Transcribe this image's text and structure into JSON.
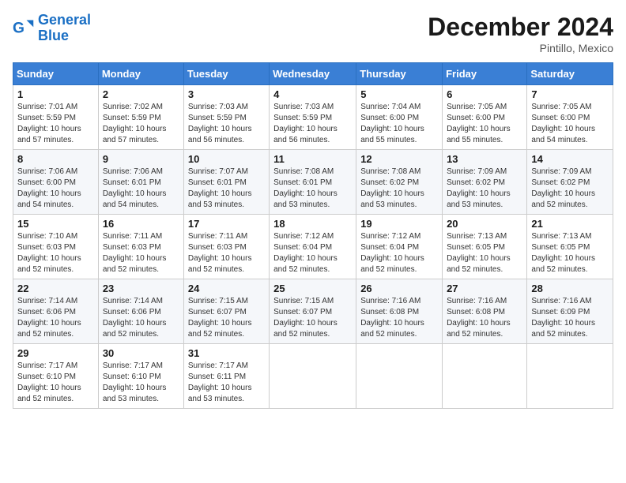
{
  "logo": {
    "line1": "General",
    "line2": "Blue"
  },
  "title": "December 2024",
  "subtitle": "Pintillo, Mexico",
  "days_header": [
    "Sunday",
    "Monday",
    "Tuesday",
    "Wednesday",
    "Thursday",
    "Friday",
    "Saturday"
  ],
  "weeks": [
    [
      {
        "day": "1",
        "info": "Sunrise: 7:01 AM\nSunset: 5:59 PM\nDaylight: 10 hours\nand 57 minutes."
      },
      {
        "day": "2",
        "info": "Sunrise: 7:02 AM\nSunset: 5:59 PM\nDaylight: 10 hours\nand 57 minutes."
      },
      {
        "day": "3",
        "info": "Sunrise: 7:03 AM\nSunset: 5:59 PM\nDaylight: 10 hours\nand 56 minutes."
      },
      {
        "day": "4",
        "info": "Sunrise: 7:03 AM\nSunset: 5:59 PM\nDaylight: 10 hours\nand 56 minutes."
      },
      {
        "day": "5",
        "info": "Sunrise: 7:04 AM\nSunset: 6:00 PM\nDaylight: 10 hours\nand 55 minutes."
      },
      {
        "day": "6",
        "info": "Sunrise: 7:05 AM\nSunset: 6:00 PM\nDaylight: 10 hours\nand 55 minutes."
      },
      {
        "day": "7",
        "info": "Sunrise: 7:05 AM\nSunset: 6:00 PM\nDaylight: 10 hours\nand 54 minutes."
      }
    ],
    [
      {
        "day": "8",
        "info": "Sunrise: 7:06 AM\nSunset: 6:00 PM\nDaylight: 10 hours\nand 54 minutes."
      },
      {
        "day": "9",
        "info": "Sunrise: 7:06 AM\nSunset: 6:01 PM\nDaylight: 10 hours\nand 54 minutes."
      },
      {
        "day": "10",
        "info": "Sunrise: 7:07 AM\nSunset: 6:01 PM\nDaylight: 10 hours\nand 53 minutes."
      },
      {
        "day": "11",
        "info": "Sunrise: 7:08 AM\nSunset: 6:01 PM\nDaylight: 10 hours\nand 53 minutes."
      },
      {
        "day": "12",
        "info": "Sunrise: 7:08 AM\nSunset: 6:02 PM\nDaylight: 10 hours\nand 53 minutes."
      },
      {
        "day": "13",
        "info": "Sunrise: 7:09 AM\nSunset: 6:02 PM\nDaylight: 10 hours\nand 53 minutes."
      },
      {
        "day": "14",
        "info": "Sunrise: 7:09 AM\nSunset: 6:02 PM\nDaylight: 10 hours\nand 52 minutes."
      }
    ],
    [
      {
        "day": "15",
        "info": "Sunrise: 7:10 AM\nSunset: 6:03 PM\nDaylight: 10 hours\nand 52 minutes."
      },
      {
        "day": "16",
        "info": "Sunrise: 7:11 AM\nSunset: 6:03 PM\nDaylight: 10 hours\nand 52 minutes."
      },
      {
        "day": "17",
        "info": "Sunrise: 7:11 AM\nSunset: 6:03 PM\nDaylight: 10 hours\nand 52 minutes."
      },
      {
        "day": "18",
        "info": "Sunrise: 7:12 AM\nSunset: 6:04 PM\nDaylight: 10 hours\nand 52 minutes."
      },
      {
        "day": "19",
        "info": "Sunrise: 7:12 AM\nSunset: 6:04 PM\nDaylight: 10 hours\nand 52 minutes."
      },
      {
        "day": "20",
        "info": "Sunrise: 7:13 AM\nSunset: 6:05 PM\nDaylight: 10 hours\nand 52 minutes."
      },
      {
        "day": "21",
        "info": "Sunrise: 7:13 AM\nSunset: 6:05 PM\nDaylight: 10 hours\nand 52 minutes."
      }
    ],
    [
      {
        "day": "22",
        "info": "Sunrise: 7:14 AM\nSunset: 6:06 PM\nDaylight: 10 hours\nand 52 minutes."
      },
      {
        "day": "23",
        "info": "Sunrise: 7:14 AM\nSunset: 6:06 PM\nDaylight: 10 hours\nand 52 minutes."
      },
      {
        "day": "24",
        "info": "Sunrise: 7:15 AM\nSunset: 6:07 PM\nDaylight: 10 hours\nand 52 minutes."
      },
      {
        "day": "25",
        "info": "Sunrise: 7:15 AM\nSunset: 6:07 PM\nDaylight: 10 hours\nand 52 minutes."
      },
      {
        "day": "26",
        "info": "Sunrise: 7:16 AM\nSunset: 6:08 PM\nDaylight: 10 hours\nand 52 minutes."
      },
      {
        "day": "27",
        "info": "Sunrise: 7:16 AM\nSunset: 6:08 PM\nDaylight: 10 hours\nand 52 minutes."
      },
      {
        "day": "28",
        "info": "Sunrise: 7:16 AM\nSunset: 6:09 PM\nDaylight: 10 hours\nand 52 minutes."
      }
    ],
    [
      {
        "day": "29",
        "info": "Sunrise: 7:17 AM\nSunset: 6:10 PM\nDaylight: 10 hours\nand 52 minutes."
      },
      {
        "day": "30",
        "info": "Sunrise: 7:17 AM\nSunset: 6:10 PM\nDaylight: 10 hours\nand 53 minutes."
      },
      {
        "day": "31",
        "info": "Sunrise: 7:17 AM\nSunset: 6:11 PM\nDaylight: 10 hours\nand 53 minutes."
      },
      null,
      null,
      null,
      null
    ]
  ]
}
